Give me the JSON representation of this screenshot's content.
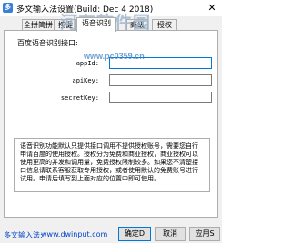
{
  "window": {
    "title": "多文输入法设置(Build: Dec  4 2018)",
    "app_icon": "多",
    "close_glyph": "✕"
  },
  "watermark": {
    "text": "河东软件园",
    "url": "www.pc0359.cn"
  },
  "tabs": [
    {
      "label": "全拼简拼"
    },
    {
      "label": "按键"
    },
    {
      "label": "语音识别"
    },
    {
      "label": "高级"
    },
    {
      "label": "授权"
    }
  ],
  "active_tab": "语音识别",
  "panel": {
    "section_label": "百度语音识别接口:",
    "fields": [
      {
        "label": "appId:",
        "value": ""
      },
      {
        "label": "apiKey:",
        "value": ""
      },
      {
        "label": "secretKey:",
        "value": ""
      }
    ],
    "note": "语音识别功能默认只提供接口调用不提供授权账号，需要您自行申请百度的使用授权。授权分为免费和商业授权，商业授权可以使用更高的并发和调用量，免费授权限制较多。如果您不清楚接口信息请联系客服获取专用授权，或者使用默认的免费账号进行试用。申请后填写到上面对应的位置中即可使用。"
  },
  "footer": {
    "link_label": "多文输入法:",
    "link_url": "www.dwinput.com",
    "ok_label": "确定D",
    "cancel_label": "取消",
    "apply_label": "应用S"
  }
}
